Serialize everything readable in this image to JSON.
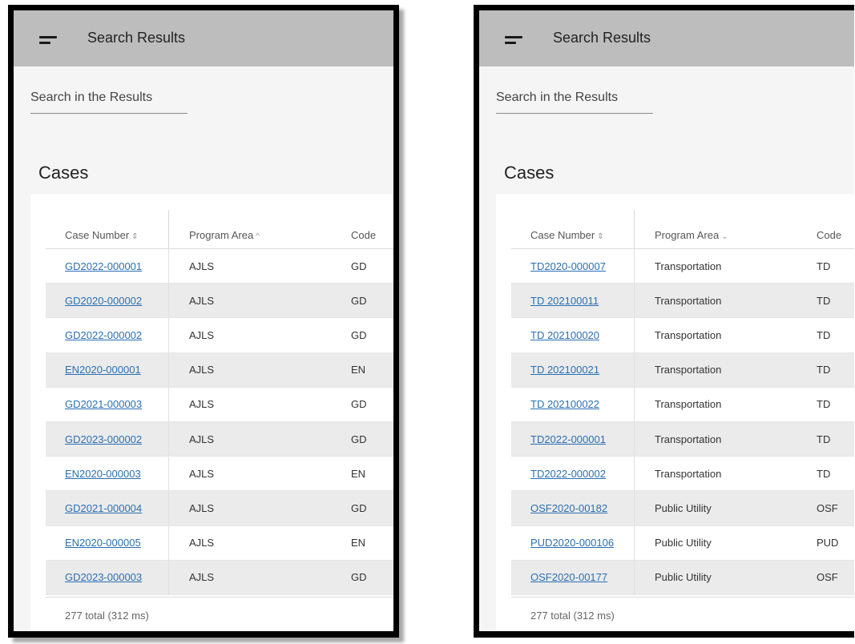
{
  "panels": [
    {
      "header_title": "Search Results",
      "search_placeholder": "Search in the Results",
      "section_title": "Cases",
      "columns": {
        "case_number": "Case Number",
        "program_area": "Program Area",
        "code": "Code"
      },
      "sort_icons": {
        "case_number": "⇕",
        "program_area": "^"
      },
      "rows": [
        {
          "case": "GD2022-000001",
          "area": "AJLS",
          "code": "GD"
        },
        {
          "case": "GD2020-000002",
          "area": "AJLS",
          "code": "GD"
        },
        {
          "case": "GD2022-000002",
          "area": "AJLS",
          "code": "GD"
        },
        {
          "case": "EN2020-000001",
          "area": "AJLS",
          "code": "EN"
        },
        {
          "case": "GD2021-000003",
          "area": "AJLS",
          "code": "GD"
        },
        {
          "case": "GD2023-000002",
          "area": "AJLS",
          "code": "GD"
        },
        {
          "case": "EN2020-000003",
          "area": "AJLS",
          "code": "EN"
        },
        {
          "case": "GD2021-000004",
          "area": "AJLS",
          "code": "GD"
        },
        {
          "case": "EN2020-000005",
          "area": "AJLS",
          "code": "EN"
        },
        {
          "case": "GD2023-000003",
          "area": "AJLS",
          "code": "GD"
        }
      ],
      "total": "277 total (312 ms)"
    },
    {
      "header_title": "Search Results",
      "search_placeholder": "Search in the Results",
      "section_title": "Cases",
      "columns": {
        "case_number": "Case Number",
        "program_area": "Program Area",
        "code": "Code"
      },
      "sort_icons": {
        "case_number": "⇕",
        "program_area": "⌄"
      },
      "rows": [
        {
          "case": "TD2020-000007",
          "area": "Transportation",
          "code": "TD"
        },
        {
          "case": "TD 202100011",
          "area": "Transportation",
          "code": "TD"
        },
        {
          "case": "TD 202100020",
          "area": "Transportation",
          "code": "TD"
        },
        {
          "case": "TD 202100021",
          "area": "Transportation",
          "code": "TD"
        },
        {
          "case": "TD 202100022",
          "area": "Transportation",
          "code": "TD"
        },
        {
          "case": "TD2022-000001",
          "area": "Transportation",
          "code": "TD"
        },
        {
          "case": "TD2022-000002",
          "area": "Transportation",
          "code": "TD"
        },
        {
          "case": "OSF2020-00182",
          "area": "Public Utility",
          "code": "OSF"
        },
        {
          "case": "PUD2020-000106",
          "area": "Public Utility",
          "code": "PUD"
        },
        {
          "case": "OSF2020-00177",
          "area": "Public Utility",
          "code": "OSF"
        }
      ],
      "total": "277 total (312 ms)"
    }
  ]
}
